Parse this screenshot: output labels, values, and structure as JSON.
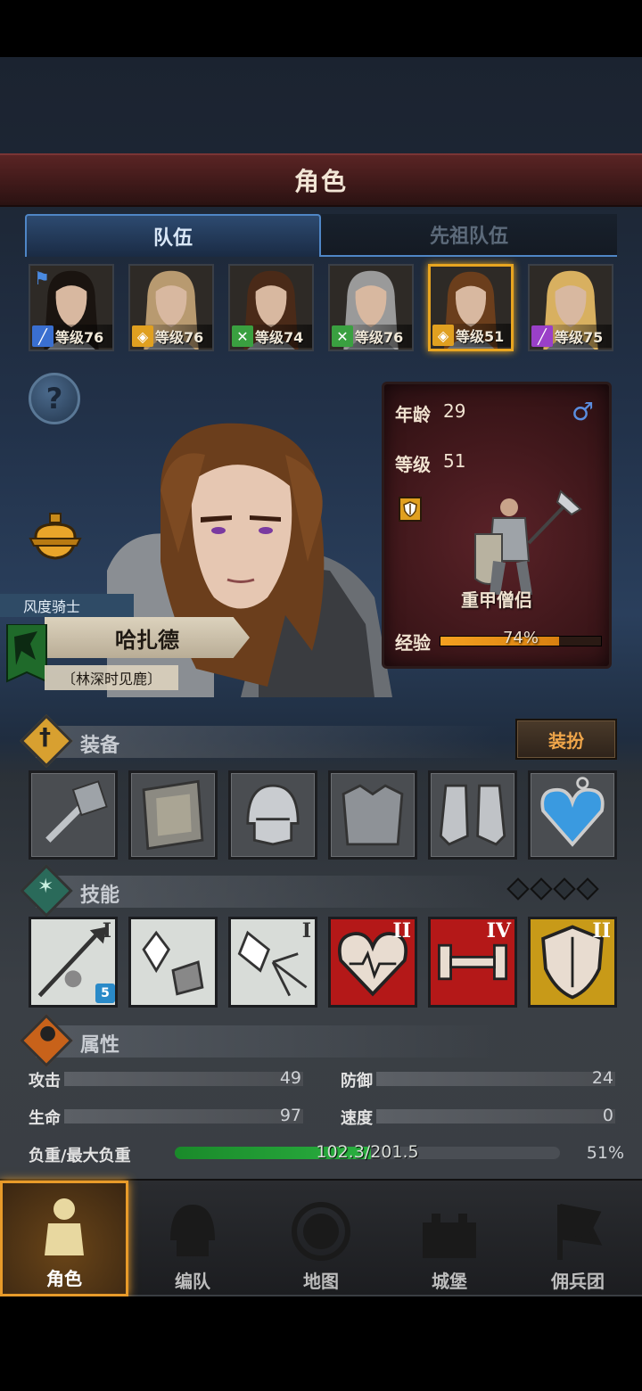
{
  "header": {
    "title": "角色"
  },
  "tabs": [
    {
      "label": "队伍"
    },
    {
      "label": "先祖队伍"
    }
  ],
  "roster": [
    {
      "level": "等级76",
      "class_icon": "sword-icon",
      "class_color": "#3a6fd0",
      "flag": true
    },
    {
      "level": "等级76",
      "class_icon": "shield-icon",
      "class_color": "#e0a020",
      "star": true
    },
    {
      "level": "等级74",
      "class_icon": "bow-icon",
      "class_color": "#3aa040"
    },
    {
      "level": "等级76",
      "class_icon": "bow-icon",
      "class_color": "#3aa040",
      "star": true
    },
    {
      "level": "等级51",
      "class_icon": "shield-icon",
      "class_color": "#e0a020",
      "selected": true
    },
    {
      "level": "等级75",
      "class_icon": "staff-icon",
      "class_color": "#9a40c8"
    }
  ],
  "character": {
    "title": "风度骑士",
    "name": "哈扎德",
    "subtitle": "〔林深时见鹿〕",
    "age_label": "年龄",
    "age": "29",
    "level_label": "等级",
    "level": "51",
    "gender_symbol": "♂",
    "class_name": "重甲僧侣",
    "exp_label": "经验",
    "exp_text": "74%",
    "exp_fraction": 0.74
  },
  "equipment": {
    "label": "装备",
    "button": "装扮",
    "slots": [
      "hammer-icon",
      "tower-shield-icon",
      "helmet-icon",
      "chest-armor-icon",
      "boots-icon",
      "heart-amulet-icon"
    ]
  },
  "skills": {
    "label": "技能",
    "items": [
      {
        "icon": "spear-strike-icon",
        "rank": "I",
        "badge": "5",
        "bg": "#d8dcd8"
      },
      {
        "icon": "crystal-heal-icon",
        "rank": "",
        "bg": "#d8dcd8"
      },
      {
        "icon": "shatter-icon",
        "rank": "I",
        "bg": "#d8dcd8"
      },
      {
        "icon": "heart-pulse-icon",
        "rank": "II",
        "bg": "#b41818"
      },
      {
        "icon": "dumbbell-icon",
        "rank": "IV",
        "bg": "#b41818"
      },
      {
        "icon": "shield-icon",
        "rank": "II",
        "bg": "#c89a18"
      }
    ]
  },
  "attributes": {
    "label": "属性",
    "attack_label": "攻击",
    "attack": "49",
    "defense_label": "防御",
    "defense": "24",
    "hp_label": "生命",
    "hp": "97",
    "speed_label": "速度",
    "speed": "0",
    "load_label": "负重/最大负重",
    "load": "102.3/201.5",
    "load_percent": "51%",
    "load_fraction": 0.51
  },
  "nav": [
    {
      "label": "角色",
      "icon": "knight-icon",
      "active": true
    },
    {
      "label": "编队",
      "icon": "helmet-icon"
    },
    {
      "label": "地图",
      "icon": "compass-map-icon"
    },
    {
      "label": "城堡",
      "icon": "castle-icon"
    },
    {
      "label": "佣兵团",
      "icon": "banner-icon"
    }
  ]
}
